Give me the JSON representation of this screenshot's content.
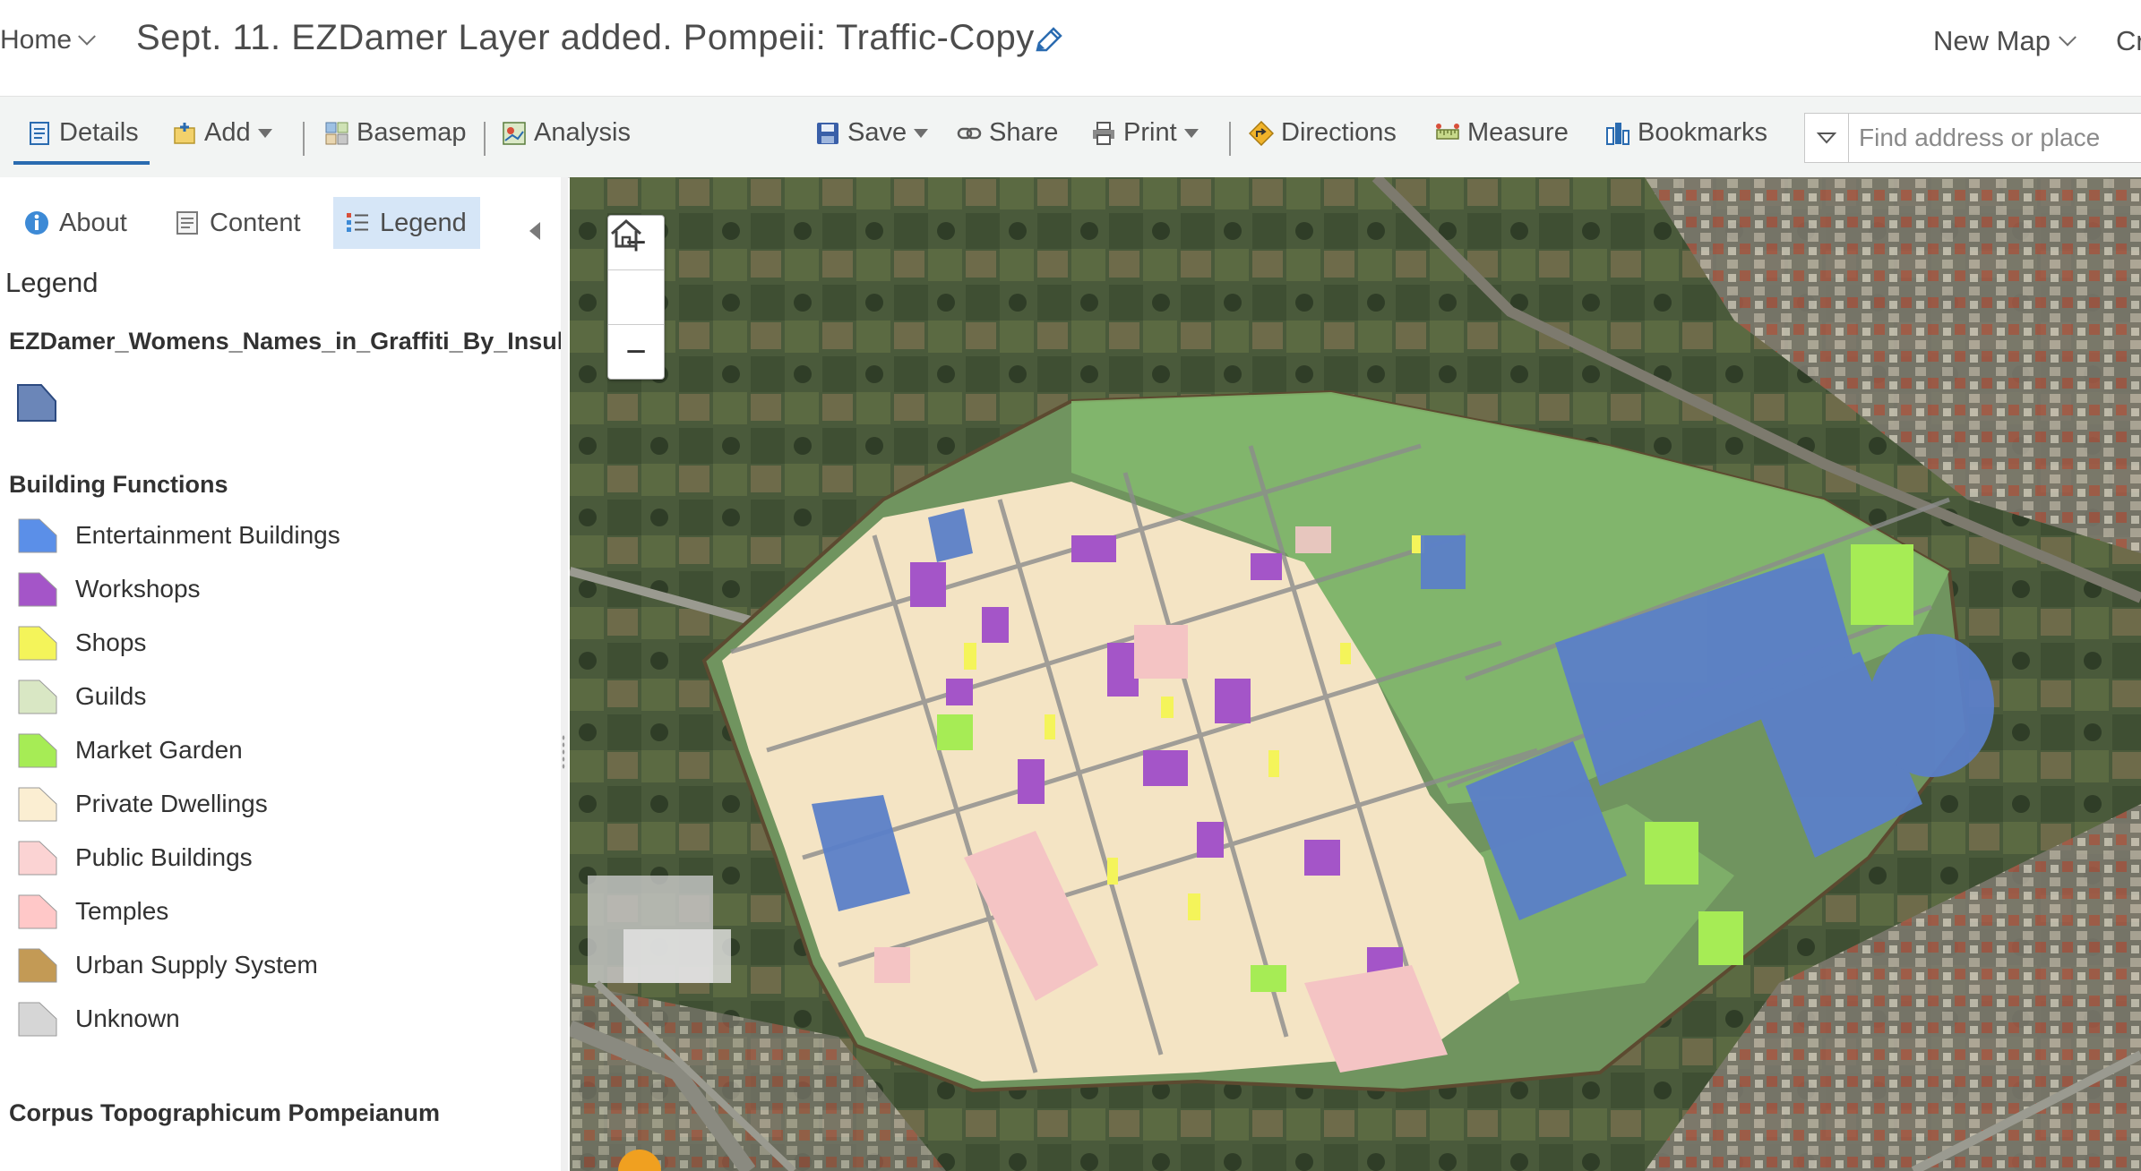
{
  "header": {
    "home_label": "Home",
    "title": "Sept. 11. EZDamer Layer added. Pompeii: Traffic-Copy",
    "new_map_label": "New Map",
    "cut_label": "Cr"
  },
  "toolbar": {
    "details": "Details",
    "add": "Add",
    "basemap": "Basemap",
    "analysis": "Analysis",
    "save": "Save",
    "share": "Share",
    "print": "Print",
    "directions": "Directions",
    "measure": "Measure",
    "bookmarks": "Bookmarks",
    "search_placeholder": "Find address or place"
  },
  "panel": {
    "tabs": {
      "about": "About",
      "content": "Content",
      "legend": "Legend"
    },
    "heading": "Legend",
    "layer1_title": "EZDamer_Womens_Names_in_Graffiti_By_Insul",
    "layer1_color": "#6b86b8",
    "section_title": "Building Functions",
    "items": [
      {
        "label": "Entertainment Buildings",
        "color": "#5b8fe8"
      },
      {
        "label": "Workshops",
        "color": "#a455c8"
      },
      {
        "label": "Shops",
        "color": "#f4f45a"
      },
      {
        "label": "Guilds",
        "color": "#d9e7c4"
      },
      {
        "label": "Market Garden",
        "color": "#a6ec55"
      },
      {
        "label": "Private Dwellings",
        "color": "#fbeed2"
      },
      {
        "label": "Public Buildings",
        "color": "#fbd3d3"
      },
      {
        "label": "Temples",
        "color": "#ffc8c8"
      },
      {
        "label": "Urban Supply System",
        "color": "#c39a55"
      },
      {
        "label": "Unknown",
        "color": "#d6d6d6"
      }
    ],
    "layer3_title": "Corpus Topographicum Pompeianum"
  },
  "map": {
    "zoom_in": "+",
    "zoom_out": "−"
  }
}
